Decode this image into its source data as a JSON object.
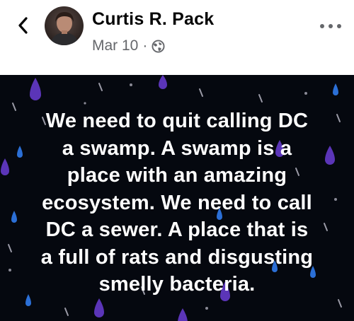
{
  "post": {
    "author_name": "Curtis R. Pack",
    "date": "Mar 10",
    "separator": "·",
    "privacy_icon": "globe-icon",
    "body_lines": [
      "We need to quit calling DC",
      "a swamp. A swamp is a",
      "place with an amazing",
      "ecosystem. We need to call",
      "DC a sewer. A place that is",
      "a full of rats and disgusting",
      "smelly bacteria."
    ]
  },
  "icons": {
    "back": "chevron-left-icon",
    "more": "more-dots-icon"
  },
  "colors": {
    "author_text": "#050505",
    "meta_text": "#65676b",
    "post_background": "#05080f",
    "raindrop_purple": "#5b35b8",
    "raindrop_blue": "#2b6fd6",
    "post_text": "#ffffff"
  }
}
